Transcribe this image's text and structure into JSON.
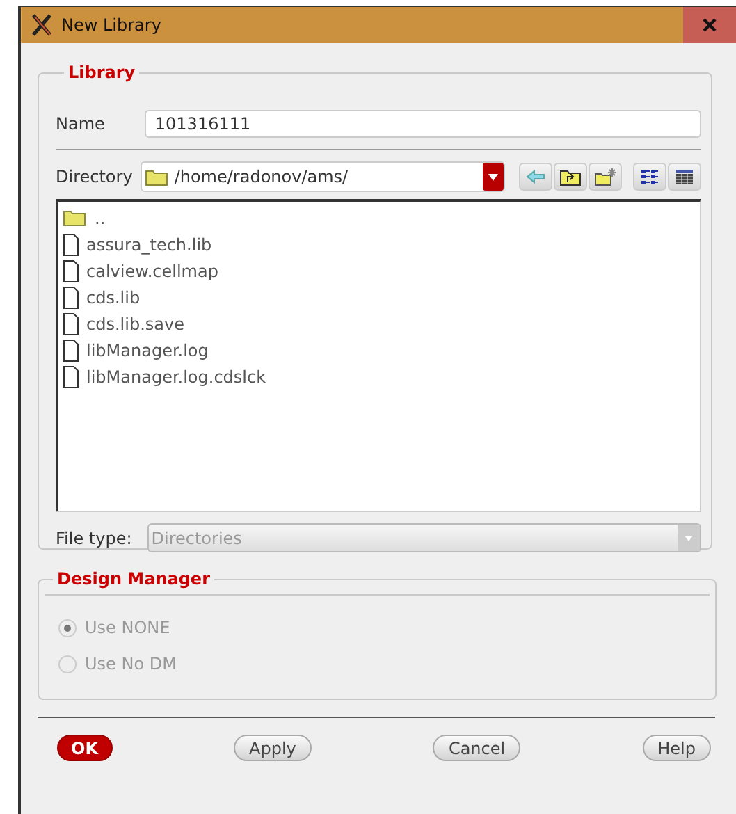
{
  "window": {
    "title": "New Library"
  },
  "library": {
    "legend": "Library",
    "name_label": "Name",
    "name_value": "101316111",
    "directory_label": "Directory",
    "directory_value": "/home/radonov/ams/",
    "files": [
      {
        "kind": "folder",
        "name": ".."
      },
      {
        "kind": "file",
        "name": "assura_tech.lib"
      },
      {
        "kind": "file",
        "name": "calview.cellmap"
      },
      {
        "kind": "file",
        "name": "cds.lib"
      },
      {
        "kind": "file",
        "name": "cds.lib.save"
      },
      {
        "kind": "file",
        "name": "libManager.log"
      },
      {
        "kind": "file",
        "name": "libManager.log.cdslck"
      }
    ],
    "file_type_label": "File type:",
    "file_type_value": "Directories",
    "file_type_disabled": true
  },
  "design_manager": {
    "legend": "Design Manager",
    "options": [
      {
        "label": "Use NONE",
        "selected": true,
        "disabled": true
      },
      {
        "label": "Use No DM",
        "selected": false,
        "disabled": true
      }
    ]
  },
  "buttons": [
    {
      "label": "OK",
      "kind": "primary"
    },
    {
      "label": "Apply",
      "kind": "normal"
    },
    {
      "label": "Cancel",
      "kind": "normal"
    },
    {
      "label": "Help",
      "kind": "normal"
    }
  ]
}
